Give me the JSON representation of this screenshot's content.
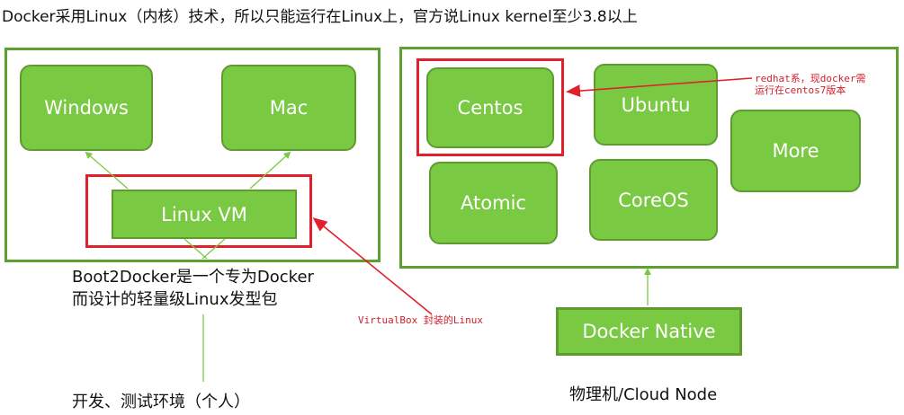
{
  "heading": "Docker采用Linux（内核）技术，所以只能运行在Linux上，官方说Linux kernel至少3.8以上",
  "left_panel": {
    "nodes": {
      "windows": "Windows",
      "mac": "Mac",
      "linux_vm": "Linux VM"
    },
    "boot2docker": [
      "Boot2Docker是一个专为Docker",
      "而设计的轻量级Linux发型包"
    ],
    "virtualbox_note": "VirtualBox 封装的Linux",
    "dev_env": "开发、测试环境（个人）"
  },
  "right_panel": {
    "nodes": {
      "centos": "Centos",
      "ubuntu": "Ubuntu",
      "more": "More",
      "atomic": "Atomic",
      "coreos": "CoreOS",
      "docker_native": "Docker Native"
    },
    "redhat_note": [
      "redhat系，现docker需",
      "运行在centos7版本"
    ],
    "physical": "物理机/Cloud Node"
  },
  "colors": {
    "node_fill": "#7ac943",
    "node_border": "#5e9c30",
    "highlight": "#e0202a",
    "panel_border": "#5da030"
  }
}
